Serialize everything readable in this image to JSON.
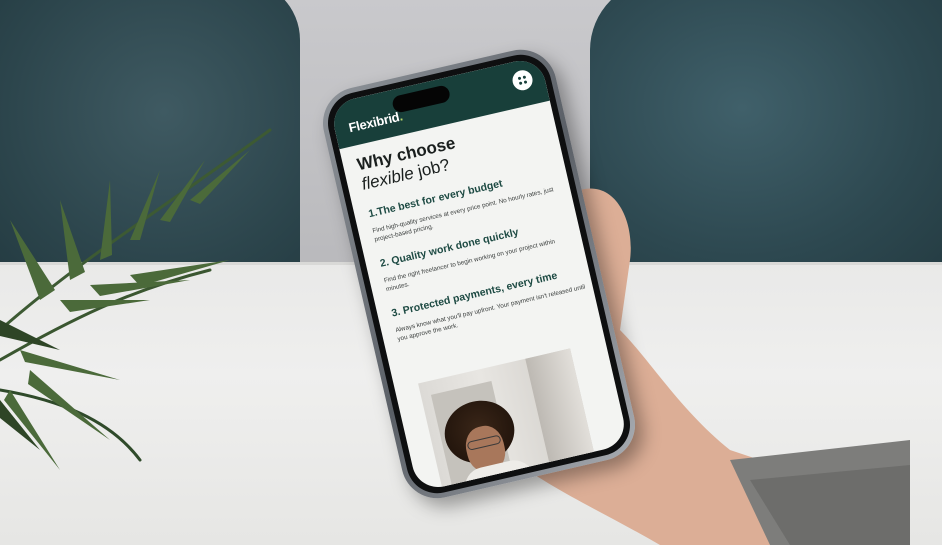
{
  "app": {
    "logo_text": "Flexibrid",
    "logo_dot": ".",
    "menu_icon": "grid-dots-icon"
  },
  "page": {
    "title_bold": "Why choose",
    "title_italic": "flexible",
    "title_rest": " job?"
  },
  "sections": [
    {
      "title": "1.The best for every budget",
      "body": "Find high-quality services at every price point. No hourly rates, just project-based pricing."
    },
    {
      "title": "2. Quality work done quickly",
      "body": "Find the right freelancer to begin working on your project within minutes."
    },
    {
      "title": "3. Protected payments, every time",
      "body": "Always know what you'll pay upfront. Your payment isn't released until you approve the work."
    }
  ],
  "colors": {
    "header": "#183f3a",
    "accent": "#b9d86a",
    "section_title": "#1d4a43"
  }
}
